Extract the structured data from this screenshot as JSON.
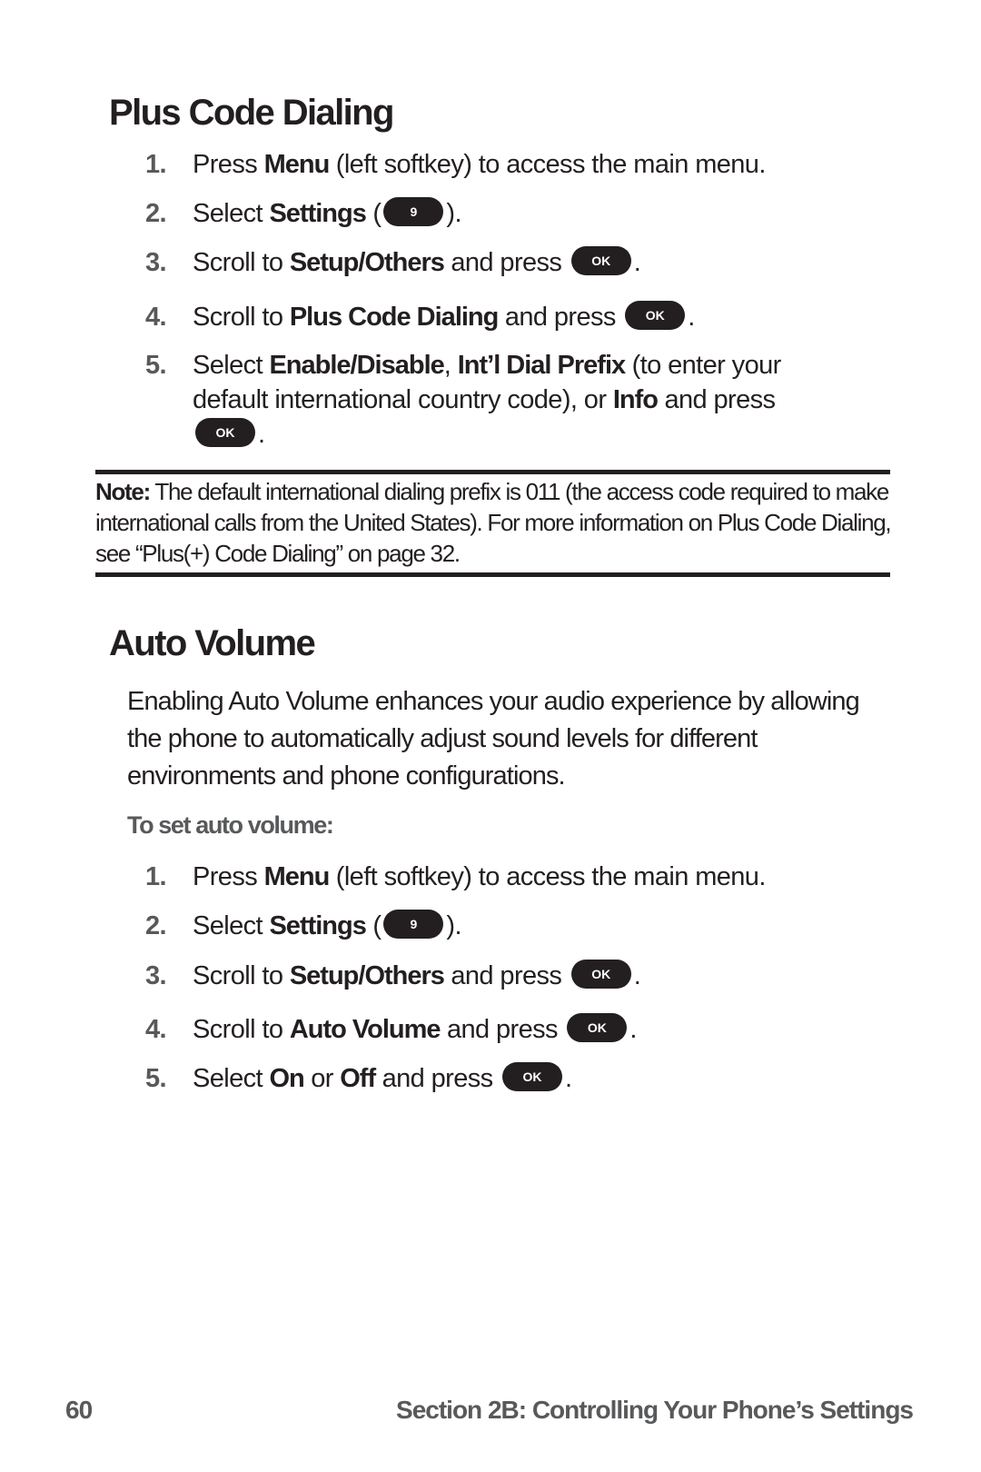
{
  "section1": {
    "title": "Plus Code Dialing",
    "steps": [
      {
        "num": "1.",
        "parts": [
          {
            "t": "Press "
          },
          {
            "b": "Menu"
          },
          {
            "t": " (left softkey) to access the main menu."
          }
        ]
      },
      {
        "num": "2.",
        "parts": [
          {
            "t": "Select "
          },
          {
            "b": "Settings"
          },
          {
            "t": " ("
          },
          {
            "key": "9"
          },
          {
            "t": ")."
          }
        ]
      },
      {
        "num": "3.",
        "parts": [
          {
            "t": "Scroll to "
          },
          {
            "b": "Setup/Others"
          },
          {
            "t": " and press "
          },
          {
            "key": "OK"
          },
          {
            "t": "."
          }
        ]
      },
      {
        "num": "4.",
        "parts": [
          {
            "t": "Scroll to "
          },
          {
            "b": "Plus Code Dialing"
          },
          {
            "t": " and press "
          },
          {
            "key": "OK"
          },
          {
            "t": "."
          }
        ]
      },
      {
        "num": "5.",
        "parts": [
          {
            "t": "Select "
          },
          {
            "b": "Enable/Disable"
          },
          {
            "t": ", "
          },
          {
            "b": "Int’l Dial Prefix"
          },
          {
            "t": " (to enter your default international country code), or "
          },
          {
            "b": "Info"
          },
          {
            "t": " and press "
          },
          {
            "key": "OK"
          },
          {
            "t": "."
          }
        ]
      }
    ]
  },
  "note": {
    "label": "Note:",
    "text": " The default international dialing prefix is 011 (the access code required to make international calls from the United States). For more information on Plus Code Dialing, see “Plus(+) Code Dialing” on page 32."
  },
  "section2": {
    "title": "Auto Volume",
    "intro": "Enabling Auto Volume enhances your audio experience by allowing the phone to automatically adjust sound levels for different environments and phone configurations.",
    "subheading": "To set auto volume:",
    "steps": [
      {
        "num": "1.",
        "parts": [
          {
            "t": "Press "
          },
          {
            "b": "Menu"
          },
          {
            "t": " (left softkey) to access the main menu."
          }
        ]
      },
      {
        "num": "2.",
        "parts": [
          {
            "t": "Select "
          },
          {
            "b": "Settings"
          },
          {
            "t": " ("
          },
          {
            "key": "9"
          },
          {
            "t": ")."
          }
        ]
      },
      {
        "num": "3.",
        "parts": [
          {
            "t": "Scroll to "
          },
          {
            "b": "Setup/Others"
          },
          {
            "t": " and press "
          },
          {
            "key": "OK"
          },
          {
            "t": "."
          }
        ]
      },
      {
        "num": "4.",
        "parts": [
          {
            "t": "Scroll to "
          },
          {
            "b": "Auto Volume"
          },
          {
            "t": " and press "
          },
          {
            "key": "OK"
          },
          {
            "t": "."
          }
        ]
      },
      {
        "num": "5.",
        "parts": [
          {
            "t": "Select "
          },
          {
            "b": "On"
          },
          {
            "t": " or "
          },
          {
            "b": "Off"
          },
          {
            "t": " and press "
          },
          {
            "key": "OK"
          },
          {
            "t": "."
          }
        ]
      }
    ]
  },
  "footer": {
    "page_number": "60",
    "section_title": "Section 2B: Controlling Your Phone’s Settings"
  },
  "colors": {
    "text": "#231f20",
    "secondary_text": "#58595b",
    "key_background": "#231f20",
    "key_text": "#ffffff"
  }
}
